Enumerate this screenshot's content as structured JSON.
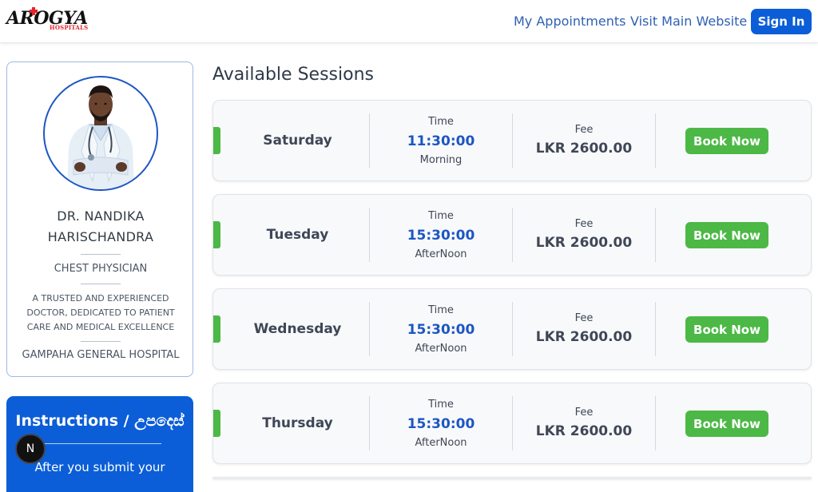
{
  "header": {
    "logo_text": "AROGYA",
    "logo_sub": "HOSPITALS",
    "nav": [
      "My Appointments",
      "Visit Main Website"
    ],
    "signin_label": "Sign In"
  },
  "doctor": {
    "name_line1": "DR. NANDIKA",
    "name_line2": "HARISCHANDRA",
    "specialty": "CHEST PHYSICIAN",
    "description": "A TRUSTED AND EXPERIENCED DOCTOR, DEDICATED TO PATIENT CARE AND MEDICAL EXCELLENCE",
    "hospital": "GAMPAHA GENERAL HOSPITAL"
  },
  "instructions": {
    "title": "Instructions / උපදෙස්",
    "text": "After you submit your",
    "badge": "N"
  },
  "sessions_title": "Available Sessions",
  "session_labels": {
    "time": "Time",
    "fee": "Fee",
    "book": "Book Now"
  },
  "sessions": [
    {
      "day": "Saturday",
      "time": "11:30:00",
      "period": "Morning",
      "fee": "LKR 2600.00"
    },
    {
      "day": "Tuesday",
      "time": "15:30:00",
      "period": "AfterNoon",
      "fee": "LKR 2600.00"
    },
    {
      "day": "Wednesday",
      "time": "15:30:00",
      "period": "AfterNoon",
      "fee": "LKR 2600.00"
    },
    {
      "day": "Thursday",
      "time": "15:30:00",
      "period": "AfterNoon",
      "fee": "LKR 2600.00"
    }
  ],
  "colors": {
    "primary": "#0b5ed7",
    "time_blue": "#1d56c4",
    "book_green": "#4cb846",
    "logo_red": "#e0262b"
  }
}
